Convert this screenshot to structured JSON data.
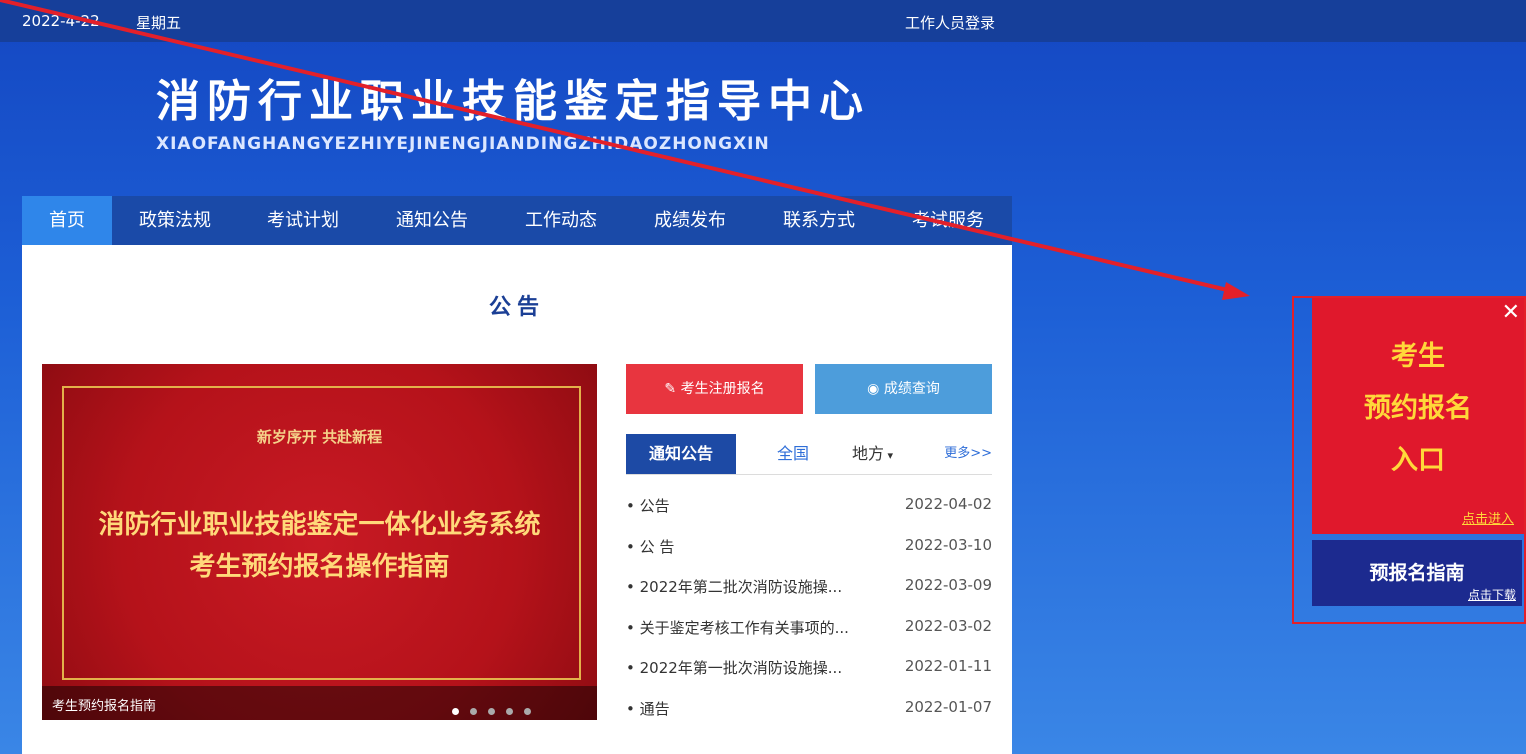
{
  "topbar": {
    "date": "2022-4-22",
    "weekday": "星期五",
    "login": "工作人员登录"
  },
  "brand": {
    "title_cn": "消防行业职业技能鉴定指导中心",
    "title_pinyin": "XIAOFANGHANGYEZHIYEJINENGJIANDINGZHIDAOZHONGXIN"
  },
  "nav": {
    "items": [
      "首页",
      "政策法规",
      "考试计划",
      "通知公告",
      "工作动态",
      "成绩发布",
      "联系方式",
      "考试服务"
    ],
    "active": "首页"
  },
  "page": {
    "title": "公告"
  },
  "banner": {
    "subtitle": "新岁序开 共赴新程",
    "headline1": "消防行业职业技能鉴定一体化业务系统",
    "headline2": "考生预约报名操作指南",
    "caption": "考生预约报名指南",
    "slide_count": 5,
    "active_slide": 1
  },
  "buttons": {
    "register": "考生注册报名",
    "score": "成绩查询"
  },
  "tabs": {
    "active": "通知公告",
    "national": "全国",
    "local": "地方",
    "more": "更多>>"
  },
  "news": [
    {
      "title": "• 公告",
      "date": "2022-04-02"
    },
    {
      "title": "• 公 告",
      "date": "2022-03-10"
    },
    {
      "title": "• 2022年第二批次消防设施操...",
      "date": "2022-03-09"
    },
    {
      "title": "• 关于鉴定考核工作有关事项的...",
      "date": "2022-03-02"
    },
    {
      "title": "• 2022年第一批次消防设施操...",
      "date": "2022-01-11"
    },
    {
      "title": "• 通告",
      "date": "2022-01-07"
    }
  ],
  "float": {
    "line1": "考生",
    "line2": "预约报名",
    "line3": "入口",
    "enter": "点击进入",
    "guide": "预报名指南",
    "download": "点击下载",
    "close": "✕"
  },
  "colors": {
    "accent_blue": "#1d4aa5",
    "register_red": "#e8353f",
    "score_blue": "#4d9ddb",
    "float_red": "#e0182c",
    "annotation_arrow": "#e3202a"
  }
}
